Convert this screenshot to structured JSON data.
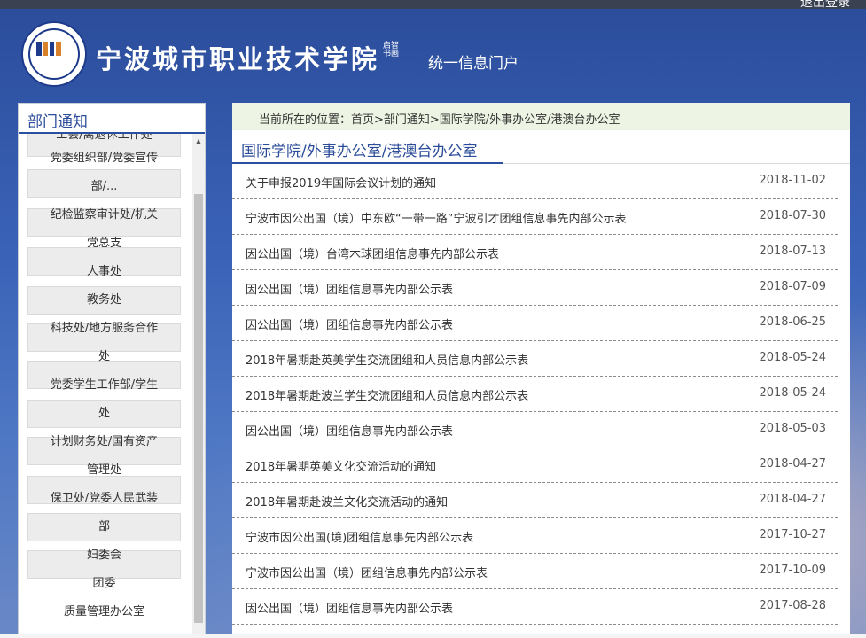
{
  "header": {
    "top_link": "退出登录",
    "school_name": "宁波城市职业技术学院",
    "motto": "启智书画",
    "portal_title": "统一信息门户"
  },
  "sidebar": {
    "title": "部门通知",
    "items": [
      {
        "lines": [
          "工会/离退休工作处"
        ]
      },
      {
        "lines": [
          "党委组织部/党委宣传",
          "部/..."
        ]
      },
      {
        "lines": [
          "纪检监察审计处/机关",
          "党总支"
        ]
      },
      {
        "lines": [
          "人事处"
        ]
      },
      {
        "lines": [
          "教务处"
        ]
      },
      {
        "lines": [
          "科技处/地方服务合作",
          "处"
        ]
      },
      {
        "lines": [
          "党委学生工作部/学生",
          "处"
        ]
      },
      {
        "lines": [
          "计划财务处/国有资产",
          "管理处"
        ]
      },
      {
        "lines": [
          "保卫处/党委人民武装",
          "部"
        ]
      },
      {
        "lines": [
          "妇委会"
        ]
      },
      {
        "lines": [
          "团委"
        ]
      },
      {
        "lines": [
          "质量管理办公室"
        ]
      }
    ],
    "scroll_up_glyph": "▲"
  },
  "breadcrumb": {
    "text": "当前所在的位置：首页>部门通知>国际学院/外事办公室/港澳台办公室"
  },
  "section": {
    "title": "国际学院/外事办公室/港澳台办公室"
  },
  "news": [
    {
      "title": "关于申报2019年国际会议计划的通知",
      "date": "2018-11-02"
    },
    {
      "title": "宁波市因公出国（境）中东欧“一带一路”宁波引才团组信息事先内部公示表",
      "date": "2018-07-30"
    },
    {
      "title": "因公出国（境）台湾木球团组信息事先内部公示表",
      "date": "2018-07-13"
    },
    {
      "title": "因公出国（境）团组信息事先内部公示表",
      "date": "2018-07-09"
    },
    {
      "title": "因公出国（境）团组信息事先内部公示表",
      "date": "2018-06-25"
    },
    {
      "title": "2018年暑期赴英美学生交流团组和人员信息内部公示表",
      "date": "2018-05-24"
    },
    {
      "title": "2018年暑期赴波兰学生交流团组和人员信息内部公示表",
      "date": "2018-05-24"
    },
    {
      "title": "因公出国（境）团组信息事先内部公示表",
      "date": "2018-05-03"
    },
    {
      "title": "2018年暑期英美文化交流活动的通知",
      "date": "2018-04-27"
    },
    {
      "title": "2018年暑期赴波兰文化交流活动的通知",
      "date": "2018-04-27"
    },
    {
      "title": "宁波市因公出国(境)团组信息事先内部公示表",
      "date": "2017-10-27"
    },
    {
      "title": "宁波市因公出国（境）团组信息事先内部公示表",
      "date": "2017-10-09"
    },
    {
      "title": "因公出国（境）团组信息事先内部公示表",
      "date": "2017-08-28"
    }
  ],
  "colors": {
    "brand_blue": "#2b4c9a",
    "breadcrumb_bg": "#edf4e3"
  }
}
